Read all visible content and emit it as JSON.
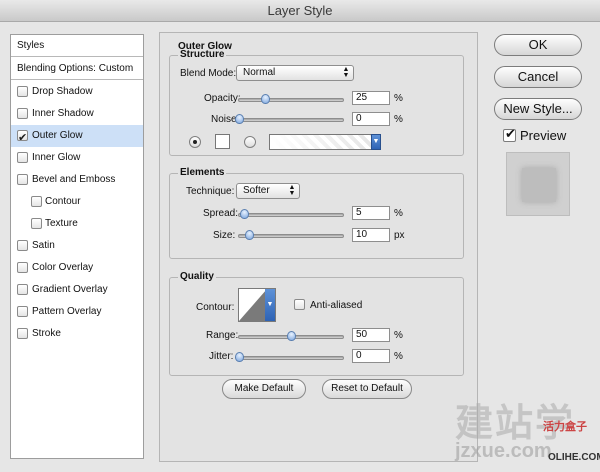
{
  "window": {
    "title": "Layer Style"
  },
  "sidebar": {
    "styles_label": "Styles",
    "blending_label": "Blending Options: Custom",
    "items": [
      {
        "label": "Drop Shadow",
        "checked": false
      },
      {
        "label": "Inner Shadow",
        "checked": false
      },
      {
        "label": "Outer Glow",
        "checked": true,
        "selected": true
      },
      {
        "label": "Inner Glow",
        "checked": false
      },
      {
        "label": "Bevel and Emboss",
        "checked": false
      },
      {
        "label": "Contour",
        "checked": false,
        "indent": true
      },
      {
        "label": "Texture",
        "checked": false,
        "indent": true
      },
      {
        "label": "Satin",
        "checked": false
      },
      {
        "label": "Color Overlay",
        "checked": false
      },
      {
        "label": "Gradient Overlay",
        "checked": false
      },
      {
        "label": "Pattern Overlay",
        "checked": false
      },
      {
        "label": "Stroke",
        "checked": false
      }
    ]
  },
  "panel": {
    "title": "Outer Glow",
    "structure": {
      "title": "Structure",
      "blend_mode_label": "Blend Mode:",
      "blend_mode_value": "Normal",
      "opacity_label": "Opacity:",
      "opacity_value": "25",
      "opacity_unit": "%",
      "opacity_level": 25,
      "noise_label": "Noise:",
      "noise_value": "0",
      "noise_unit": "%",
      "noise_level": 0
    },
    "elements": {
      "title": "Elements",
      "technique_label": "Technique:",
      "technique_value": "Softer",
      "spread_label": "Spread:",
      "spread_value": "5",
      "spread_unit": "%",
      "spread_level": 5,
      "size_label": "Size:",
      "size_value": "10",
      "size_unit": "px",
      "size_level": 10
    },
    "quality": {
      "title": "Quality",
      "contour_label": "Contour:",
      "antialiased_label": "Anti-aliased",
      "range_label": "Range:",
      "range_value": "50",
      "range_unit": "%",
      "range_level": 50,
      "jitter_label": "Jitter:",
      "jitter_value": "0",
      "jitter_unit": "%",
      "jitter_level": 0
    },
    "make_default_label": "Make Default",
    "reset_default_label": "Reset to Default"
  },
  "actions": {
    "ok_label": "OK",
    "cancel_label": "Cancel",
    "new_style_label": "New Style...",
    "preview_label": "Preview"
  },
  "watermark": {
    "line1": "建站学",
    "line2": "jzxue.com",
    "brand": "活力盒子",
    "brand_url": "OLIHE.COM"
  }
}
